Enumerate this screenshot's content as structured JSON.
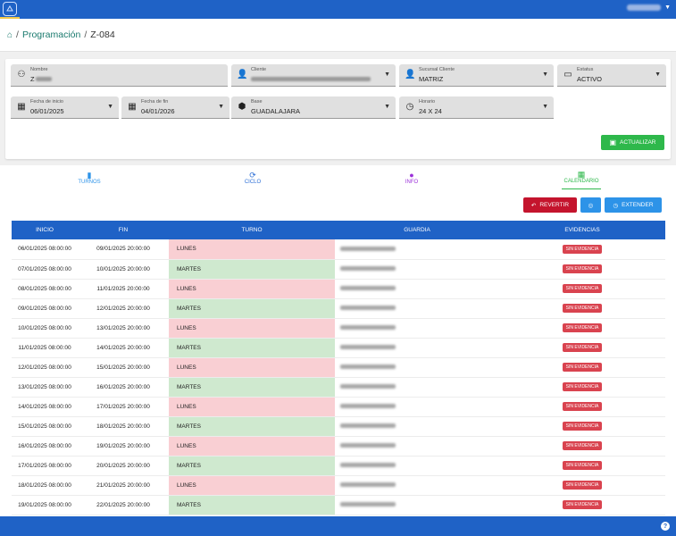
{
  "breadcrumb": {
    "section": "Programación",
    "current": "Z-084",
    "separator": "/"
  },
  "form": {
    "nombre": {
      "label": "Nombre",
      "value": "Z"
    },
    "cliente": {
      "label": "Cliente"
    },
    "sucursal": {
      "label": "Sucursal Cliente",
      "value": "MATRIZ"
    },
    "estatus": {
      "label": "Estatus",
      "value": "ACTIVO"
    },
    "fecha_inicio": {
      "label": "Fecha de inicio",
      "value": "06/01/2025"
    },
    "fecha_fin": {
      "label": "Fecha de fin",
      "value": "04/01/2026"
    },
    "base": {
      "label": "Base",
      "value": "GUADALAJARA"
    },
    "horario": {
      "label": "Horario",
      "value": "24 X 24"
    },
    "update_label": "ACTUALIZAR"
  },
  "tabs": [
    {
      "label": "TURNOS",
      "color": "#2d93e8"
    },
    {
      "label": "CICLO",
      "color": "#2d6fd6"
    },
    {
      "label": "INFO",
      "color": "#9b30d9"
    },
    {
      "label": "CALENDARIO",
      "color": "#2eb84b"
    }
  ],
  "actions": {
    "revert_label": "REVERTIR",
    "extend_label": "EXTENDER"
  },
  "table": {
    "headers": [
      "INICIO",
      "FIN",
      "TURNO",
      "GUARDIA",
      "EVIDENCIAS"
    ],
    "rows": [
      {
        "start": "06/01/2025 08:00:00",
        "end": "09/01/2025 20:00:00",
        "turno": "LUNES",
        "evidencia": "SIN EVIDENCIA"
      },
      {
        "start": "07/01/2025 08:00:00",
        "end": "10/01/2025 20:00:00",
        "turno": "MARTES",
        "evidencia": "SIN EVIDENCIA"
      },
      {
        "start": "08/01/2025 08:00:00",
        "end": "11/01/2025 20:00:00",
        "turno": "LUNES",
        "evidencia": "SIN EVIDENCIA"
      },
      {
        "start": "09/01/2025 08:00:00",
        "end": "12/01/2025 20:00:00",
        "turno": "MARTES",
        "evidencia": "SIN EVIDENCIA"
      },
      {
        "start": "10/01/2025 08:00:00",
        "end": "13/01/2025 20:00:00",
        "turno": "LUNES",
        "evidencia": "SIN EVIDENCIA"
      },
      {
        "start": "11/01/2025 08:00:00",
        "end": "14/01/2025 20:00:00",
        "turno": "MARTES",
        "evidencia": "SIN EVIDENCIA"
      },
      {
        "start": "12/01/2025 08:00:00",
        "end": "15/01/2025 20:00:00",
        "turno": "LUNES",
        "evidencia": "SIN EVIDENCIA"
      },
      {
        "start": "13/01/2025 08:00:00",
        "end": "16/01/2025 20:00:00",
        "turno": "MARTES",
        "evidencia": "SIN EVIDENCIA"
      },
      {
        "start": "14/01/2025 08:00:00",
        "end": "17/01/2025 20:00:00",
        "turno": "LUNES",
        "evidencia": "SIN EVIDENCIA"
      },
      {
        "start": "15/01/2025 08:00:00",
        "end": "18/01/2025 20:00:00",
        "turno": "MARTES",
        "evidencia": "SIN EVIDENCIA"
      },
      {
        "start": "16/01/2025 08:00:00",
        "end": "19/01/2025 20:00:00",
        "turno": "LUNES",
        "evidencia": "SIN EVIDENCIA"
      },
      {
        "start": "17/01/2025 08:00:00",
        "end": "20/01/2025 20:00:00",
        "turno": "MARTES",
        "evidencia": "SIN EVIDENCIA"
      },
      {
        "start": "18/01/2025 08:00:00",
        "end": "21/01/2025 20:00:00",
        "turno": "LUNES",
        "evidencia": "SIN EVIDENCIA"
      },
      {
        "start": "19/01/2025 08:00:00",
        "end": "22/01/2025 20:00:00",
        "turno": "MARTES",
        "evidencia": "SIN EVIDENCIA"
      }
    ]
  },
  "colors": {
    "primary": "#1f62c6",
    "success": "#2eb84b",
    "danger": "#c4142d",
    "info": "#2d93e8",
    "lunes_bg": "#f9cfd3",
    "martes_bg": "#cfe9cf"
  },
  "footer": {
    "help_label": "?"
  }
}
